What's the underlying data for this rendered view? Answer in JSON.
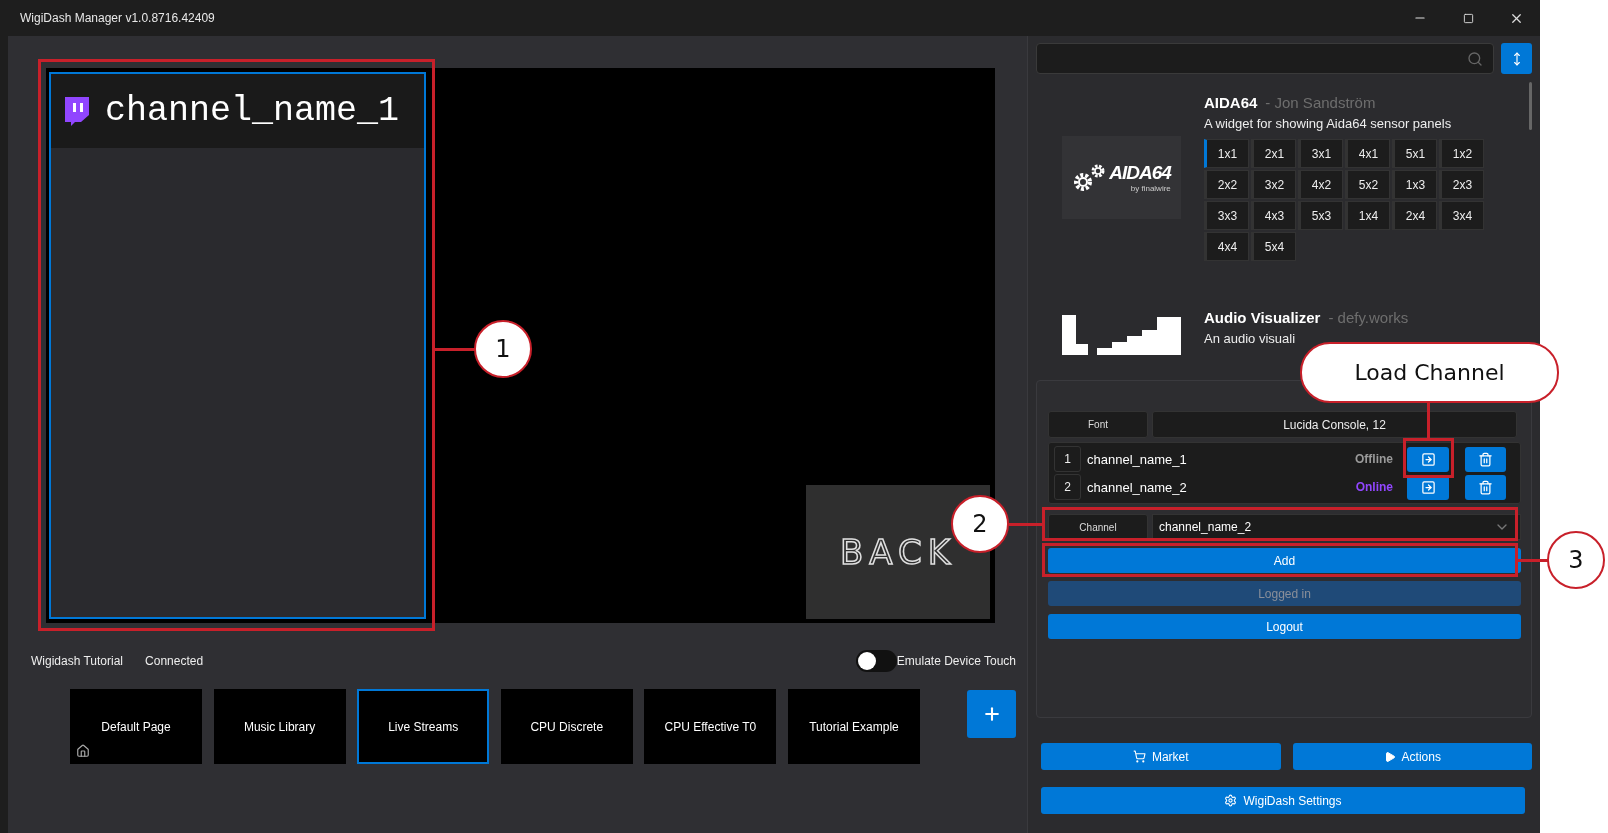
{
  "window": {
    "title": "WigiDash Manager v1.0.8716.42409"
  },
  "preview": {
    "channel_widget": {
      "channel": "channel_name_1"
    },
    "back_tile": {
      "label": "BACK"
    }
  },
  "status": {
    "device": "Wigidash Tutorial",
    "connection": "Connected",
    "emulate_touch": {
      "label": "Emulate Device Touch",
      "on": false
    }
  },
  "pages": [
    {
      "label": "Default Page",
      "selected": false,
      "home": true
    },
    {
      "label": "Music Library",
      "selected": false,
      "home": false
    },
    {
      "label": "Live Streams",
      "selected": true,
      "home": false
    },
    {
      "label": "CPU Discrete",
      "selected": false,
      "home": false
    },
    {
      "label": "CPU Effective T0",
      "selected": false,
      "home": false
    },
    {
      "label": "Tutorial Example",
      "selected": false,
      "home": false
    }
  ],
  "widgets": [
    {
      "kind": "aida",
      "logo_text": "AIDA64",
      "logo_subtext": "by finalwire",
      "name": "AIDA64",
      "author": "- Jon Sandström",
      "description": "A widget for showing Aida64 sensor panels",
      "sizes": [
        {
          "label": "1x1",
          "selected": true
        },
        {
          "label": "2x1",
          "selected": false
        },
        {
          "label": "3x1",
          "selected": false
        },
        {
          "label": "4x1",
          "selected": false
        },
        {
          "label": "5x1",
          "selected": false
        },
        {
          "label": "1x2",
          "selected": false
        },
        {
          "label": "2x2",
          "selected": false
        },
        {
          "label": "3x2",
          "selected": false
        },
        {
          "label": "4x2",
          "selected": false
        },
        {
          "label": "5x2",
          "selected": false
        },
        {
          "label": "1x3",
          "selected": false
        },
        {
          "label": "2x3",
          "selected": false
        },
        {
          "label": "3x3",
          "selected": false
        },
        {
          "label": "4x3",
          "selected": false
        },
        {
          "label": "5x3",
          "selected": false
        },
        {
          "label": "1x4",
          "selected": false
        },
        {
          "label": "2x4",
          "selected": false
        },
        {
          "label": "3x4",
          "selected": false
        },
        {
          "label": "4x4",
          "selected": false
        },
        {
          "label": "5x4",
          "selected": false
        }
      ]
    },
    {
      "kind": "audio",
      "name": "Audio Visualizer",
      "author": "- defy.works",
      "description": "An audio visuali"
    }
  ],
  "settings": {
    "font": {
      "label": "Font",
      "value": "Lucida Console, 12"
    },
    "channels": [
      {
        "index": "1",
        "name": "channel_name_1",
        "status": "Offline",
        "online": false
      },
      {
        "index": "2",
        "name": "channel_name_2",
        "status": "Online",
        "online": true
      }
    ],
    "channel_select": {
      "label": "Channel",
      "value": "channel_name_2"
    },
    "buttons": [
      {
        "label": "Add",
        "disabled": false
      },
      {
        "label": "Logged in",
        "disabled": true
      },
      {
        "label": "Logout",
        "disabled": false
      }
    ]
  },
  "footer_buttons": [
    {
      "kind": "market",
      "label": "Market"
    },
    {
      "kind": "actions",
      "label": "Actions"
    },
    {
      "kind": "settings",
      "label": "WigiDash Settings"
    }
  ],
  "annotations": [
    {
      "kind": "marker",
      "label": "1"
    },
    {
      "kind": "callout",
      "label": "Load Channel"
    },
    {
      "kind": "marker",
      "label": "2"
    },
    {
      "kind": "marker",
      "label": "3"
    }
  ]
}
